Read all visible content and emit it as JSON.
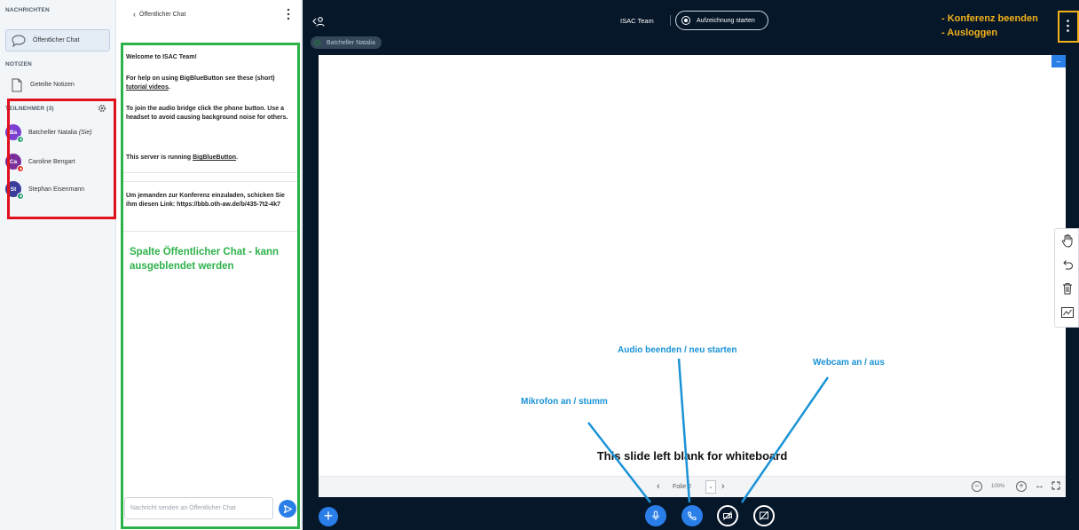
{
  "userlist": {
    "messages_title": "NACHRICHTEN",
    "public_chat_label": "Öffentlicher Chat",
    "notes_title": "NOTIZEN",
    "shared_notes_label": "Geteilte Notizen",
    "participants_title": "TEILNEHMER (3)",
    "participants": [
      {
        "initials": "Ba",
        "name": "Batcheller Natalia",
        "suffix": " (Sie)",
        "color": "#7b3fd1",
        "status_color": "#1b9a6c"
      },
      {
        "initials": "Ca",
        "name": "Caroline Bengart",
        "suffix": "",
        "color": "#7a2f9a",
        "status_color": "#e0281a"
      },
      {
        "initials": "St",
        "name": "Stephan Eisenmann",
        "suffix": "",
        "color": "#3a3d9c",
        "status_color": "#1b9a6c"
      }
    ]
  },
  "chat": {
    "back_label": "Öffentlicher Chat",
    "welcome_title": "Welcome to ISAC Team!",
    "help_pre": "For help on using BigBlueButton see these (short) ",
    "help_link": "tutorial videos",
    "help_post": ".",
    "audio_text": "To join the audio bridge click the phone button. Use a headset to avoid causing background noise for others.",
    "server_pre": "This server is running ",
    "server_link": "BigBlueButton",
    "server_post": ".",
    "invite_text": "Um jemanden zur Konferenz einzuladen, schicken Sie ihm diesen Link: https://bbb.oth-aw.de/b/435-7t2-4k7",
    "input_placeholder": "Nachricht senden an Öffentlicher Chat"
  },
  "annotations": {
    "green_note": "Spalte Öffentlicher Chat - kann ausgeblendet werden",
    "orange_line1": "- Konferenz beenden",
    "orange_line2": "- Ausloggen",
    "audio": "Audio beenden / neu starten",
    "webcam": "Webcam an / aus",
    "mic": "Mikrofon an / stumm"
  },
  "topbar": {
    "meeting_name": "ISAC Team",
    "record_label": "Aufzeichnung starten",
    "presenter_name": "Batcheller Natalia"
  },
  "whiteboard": {
    "slide_text": "This slide left blank for whiteboard",
    "slide_label": "Folie 2",
    "zoom_level": "100%"
  },
  "colors": {
    "accent": "#2a7ee8",
    "main_bg": "#06172a",
    "annotation_blue": "#1a93d6",
    "annotation_green": "#2db24a",
    "annotation_orange": "#f3b21a",
    "annotation_red": "#e0101c"
  }
}
